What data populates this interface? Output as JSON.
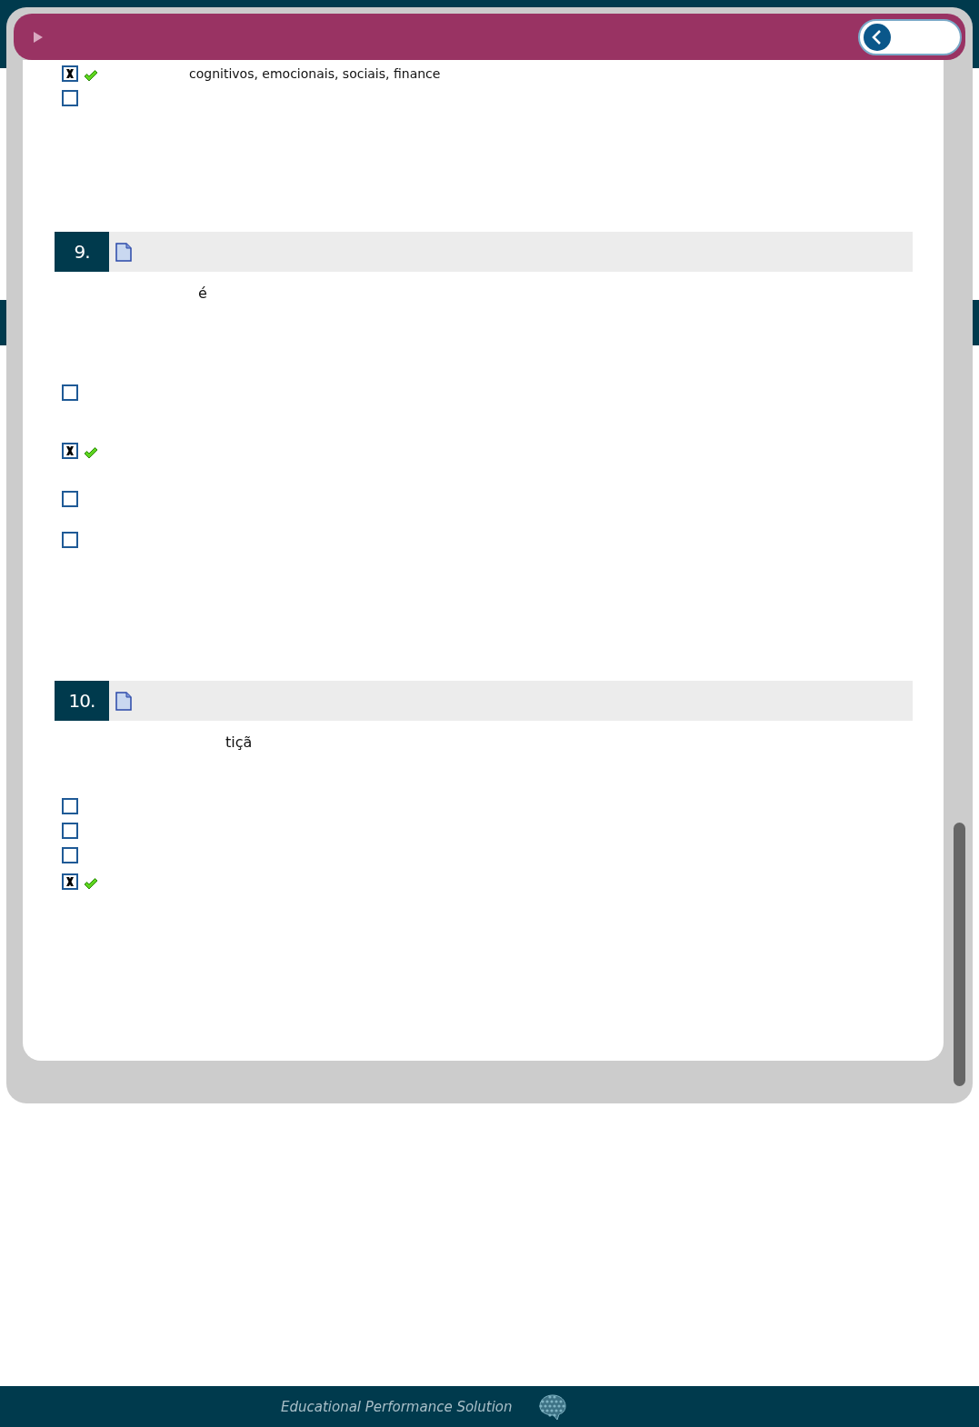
{
  "previous_question": {
    "options": [
      {
        "checked": true,
        "correct": true,
        "text": "cognitivos, emocionais, sociais, finance"
      },
      {
        "checked": false,
        "correct": false
      }
    ]
  },
  "questions": [
    {
      "number": "9.",
      "stem": "é",
      "options": [
        {
          "checked": false,
          "correct": false
        },
        {
          "checked": true,
          "correct": true
        },
        {
          "checked": false,
          "correct": false
        },
        {
          "checked": false,
          "correct": false
        }
      ]
    },
    {
      "number": "10.",
      "stem": "tiçã",
      "options": [
        {
          "checked": false,
          "correct": false
        },
        {
          "checked": false,
          "correct": false
        },
        {
          "checked": false,
          "correct": false
        },
        {
          "checked": true,
          "correct": true
        }
      ]
    }
  ],
  "footer": {
    "text": "Educational Performance Solution"
  }
}
